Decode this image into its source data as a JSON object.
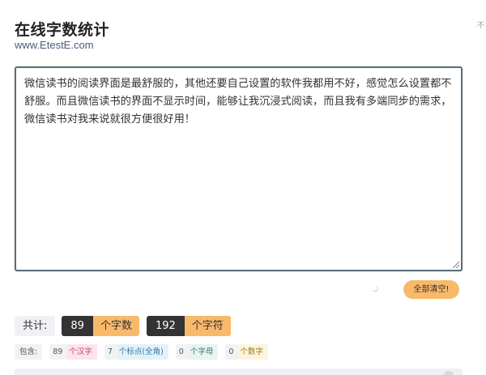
{
  "header": {
    "title": "在线字数统计",
    "subtitle": "www.EtestE.com",
    "corner_text": "不"
  },
  "editor": {
    "content": "微信读书的阅读界面是最舒服的，其他还要自己设置的软件我都用不好，感觉怎么设置都不舒服。而且微信读书的界面不显示时间，能够让我沉浸式阅读，而且我有多端同步的需求，微信读书对我来说就很方便很好用！"
  },
  "actions": {
    "clear_label": "全部清空!"
  },
  "summary": {
    "label": "共计:",
    "chars_count": "89",
    "chars_unit": "个字数",
    "symbols_count": "192",
    "symbols_unit": "个字符"
  },
  "details": {
    "label": "包含:",
    "hanzi_count": "89",
    "hanzi_unit": "个汉字",
    "punct_count": "7",
    "punct_unit": "个标点(全角)",
    "letter_count": "0",
    "letter_unit": "个字母",
    "digit_count": "0",
    "digit_unit": "个数字"
  },
  "colors": {
    "accent": "#f9b96a",
    "dark": "#333333"
  }
}
